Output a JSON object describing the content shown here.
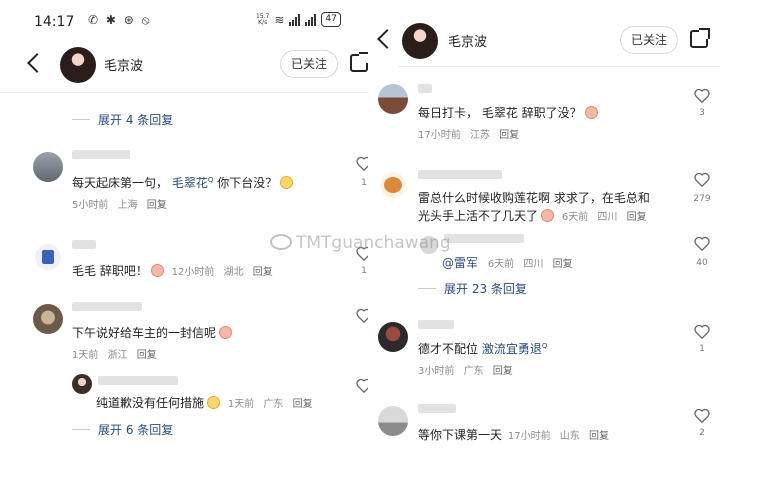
{
  "status_bar": {
    "time": "14:17",
    "net_speed": "15.7",
    "net_unit": "K/s",
    "battery": "47"
  },
  "profile": {
    "name": "毛京波",
    "follow_label": "已关注"
  },
  "watermark": "TMTguanchawang",
  "left": {
    "expand_top": "展开 4 条回复",
    "comments": [
      {
        "pre": "每天起床第一句，",
        "link": "毛翠花",
        "post": "你下台没？",
        "time": "5小时前",
        "loc": "上海",
        "reply": "回复",
        "likes": "1"
      },
      {
        "pre": "毛毛 辞职吧！",
        "time": "12小时前",
        "loc": "湖北",
        "reply": "回复",
        "likes": "1"
      },
      {
        "pre": "下午说好给车主的一封信呢",
        "time": "1天前",
        "loc": "浙江",
        "reply": "回复",
        "likes": ""
      },
      {
        "pre": "纯道歉没有任何措施",
        "time": "1天前",
        "loc": "广东",
        "reply": "回复",
        "likes": ""
      }
    ],
    "expand_bottom": "展开 6 条回复"
  },
  "right": {
    "comments": [
      {
        "pre": "每日打卡， 毛翠花 辞职了没？",
        "time": "17小时前",
        "loc": "江苏",
        "reply": "回复",
        "likes": "3"
      },
      {
        "line1": "雷总什么时候收购莲花啊 求求了，在毛总和",
        "line2": "光头手上活不了几天了",
        "time": "6天前",
        "loc": "四川",
        "reply": "回复",
        "likes": "279"
      },
      {
        "pre": "@雷军",
        "time": "6天前",
        "loc": "四川",
        "reply": "回复",
        "likes": "40"
      },
      {
        "pre": "德才不配位 ",
        "link": "激流宜勇退",
        "time": "3小时前",
        "loc": "广东",
        "reply": "回复",
        "likes": "1"
      },
      {
        "pre": "等你下课第一天",
        "time": "17小时前",
        "loc": "山东",
        "reply": "回复",
        "likes": "2"
      }
    ],
    "expand": "展开 23 条回复"
  },
  "colors": {
    "link": "#2b4a7a",
    "meta": "#8a8a8a"
  }
}
